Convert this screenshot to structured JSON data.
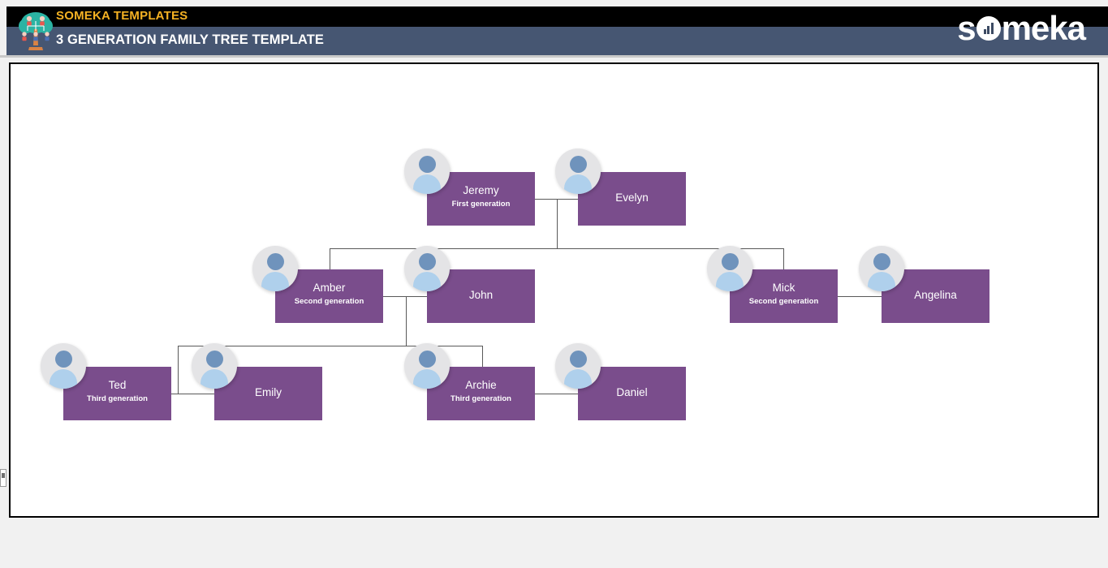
{
  "header": {
    "brand_small": "SOMEKA TEMPLATES",
    "title": "3 GENERATION FAMILY TREE TEMPLATE",
    "logo_text_left": "s",
    "logo_text_right": "meka",
    "colors": {
      "black_band": "#000000",
      "slate_band": "#465672",
      "brand_yellow": "#f5b223",
      "title_white": "#ffffff"
    }
  },
  "chart": {
    "node_color": "#7a4d8c",
    "line_color": "#595959",
    "nodes": [
      {
        "id": "jeremy",
        "name": "Jeremy",
        "subtitle": "First generation",
        "generation": 1
      },
      {
        "id": "evelyn",
        "name": "Evelyn",
        "subtitle": "",
        "generation": 1
      },
      {
        "id": "amber",
        "name": "Amber",
        "subtitle": "Second generation",
        "generation": 2
      },
      {
        "id": "john",
        "name": "John",
        "subtitle": "",
        "generation": 2
      },
      {
        "id": "mick",
        "name": "Mick",
        "subtitle": "Second generation",
        "generation": 2
      },
      {
        "id": "angelina",
        "name": "Angelina",
        "subtitle": "",
        "generation": 2
      },
      {
        "id": "ted",
        "name": "Ted",
        "subtitle": "Third generation",
        "generation": 3
      },
      {
        "id": "emily",
        "name": "Emily",
        "subtitle": "",
        "generation": 3
      },
      {
        "id": "archie",
        "name": "Archie",
        "subtitle": "Third generation",
        "generation": 3
      },
      {
        "id": "daniel",
        "name": "Daniel",
        "subtitle": "",
        "generation": 3
      }
    ]
  }
}
